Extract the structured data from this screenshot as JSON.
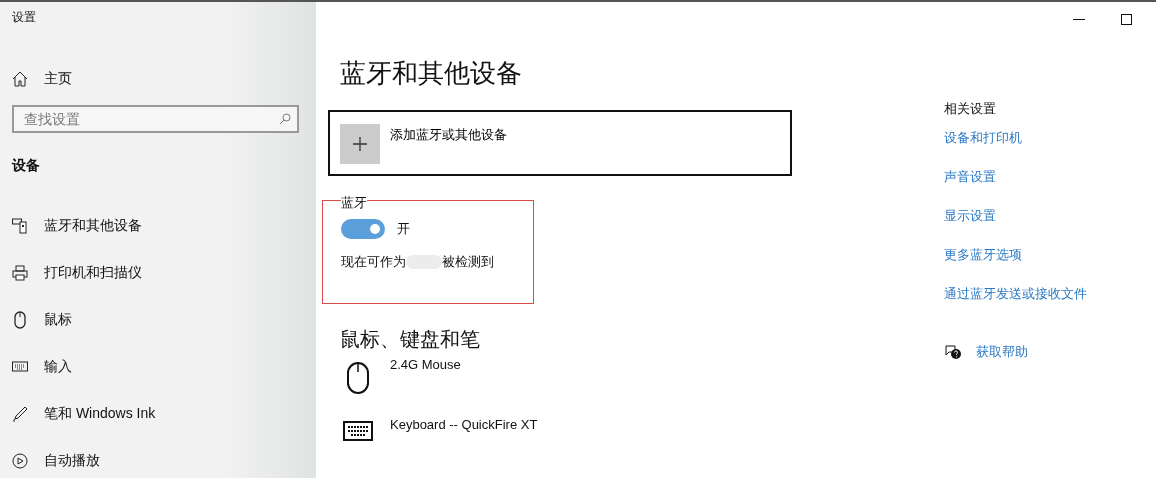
{
  "window": {
    "title": "设置"
  },
  "sidebar": {
    "home": "主页",
    "search": {
      "placeholder": "查找设置"
    },
    "section": "设备",
    "items": [
      {
        "label": "蓝牙和其他设备",
        "kind": "bluetooth",
        "selected": false
      },
      {
        "label": "打印机和扫描仪",
        "kind": "printer",
        "selected": false
      },
      {
        "label": "鼠标",
        "kind": "mouse",
        "selected": false
      },
      {
        "label": "输入",
        "kind": "keyboard",
        "selected": false
      },
      {
        "label": "笔和 Windows Ink",
        "kind": "pen",
        "selected": false
      },
      {
        "label": "自动播放",
        "kind": "autoplay",
        "selected": false
      }
    ]
  },
  "main": {
    "title": "蓝牙和其他设备",
    "add_device": "添加蓝牙或其他设备",
    "bluetooth": {
      "label": "蓝牙",
      "on": true,
      "state_text": "开",
      "status_before": "现在可作为",
      "status_after": "被检测到"
    },
    "section": "鼠标、键盘和笔",
    "devices": [
      {
        "name": "2.4G Mouse",
        "kind": "mouse"
      },
      {
        "name": "Keyboard -- QuickFire XT",
        "kind": "keyboard"
      }
    ]
  },
  "related": {
    "title": "相关设置",
    "links": [
      "设备和打印机",
      "声音设置",
      "显示设置",
      "更多蓝牙选项",
      "通过蓝牙发送或接收文件"
    ],
    "help": "获取帮助"
  }
}
